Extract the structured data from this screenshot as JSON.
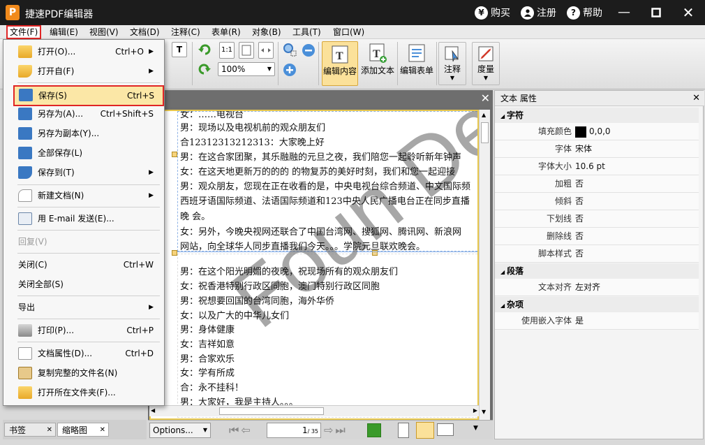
{
  "window": {
    "title": "捷速PDF编辑器",
    "logo_letter": "P",
    "links": [
      "购买",
      "注册",
      "帮助"
    ]
  },
  "menubar": [
    "文件(F)",
    "编辑(E)",
    "视图(V)",
    "文档(D)",
    "注释(C)",
    "表单(R)",
    "对象(B)",
    "工具(T)",
    "窗口(W)"
  ],
  "toolbar": {
    "zoom": "100%",
    "buttons": [
      "编辑内容",
      "添加文本",
      "编辑表单",
      "注释",
      "度量"
    ]
  },
  "file_menu": [
    {
      "label": "打开(O)...",
      "shortcut": "Ctrl+O",
      "submenu": true
    },
    {
      "label": "打开自(F)",
      "shortcut": "",
      "submenu": true
    },
    {
      "label": "保存(S)",
      "shortcut": "Ctrl+S",
      "submenu": false
    },
    {
      "label": "另存为(A)...",
      "shortcut": "Ctrl+Shift+S",
      "submenu": false
    },
    {
      "label": "另存为副本(Y)...",
      "shortcut": "",
      "submenu": false
    },
    {
      "label": "全部保存(L)",
      "shortcut": "",
      "submenu": false
    },
    {
      "label": "保存到(T)",
      "shortcut": "",
      "submenu": true
    },
    {
      "label": "新建文档(N)",
      "shortcut": "",
      "submenu": true
    },
    {
      "label": "用 E-mail 发送(E)...",
      "shortcut": "",
      "submenu": false
    },
    {
      "label": "回复(V)",
      "shortcut": "",
      "submenu": false
    },
    {
      "label": "关闭(C)",
      "shortcut": "Ctrl+W",
      "submenu": false
    },
    {
      "label": "关闭全部(S)",
      "shortcut": "",
      "submenu": false
    },
    {
      "label": "导出",
      "shortcut": "",
      "submenu": true
    },
    {
      "label": "打印(P)...",
      "shortcut": "Ctrl+P",
      "submenu": false
    },
    {
      "label": "文档属性(D)...",
      "shortcut": "Ctrl+D",
      "submenu": false
    },
    {
      "label": "复制完整的文件名(N)",
      "shortcut": "",
      "submenu": false
    },
    {
      "label": "打开所在文件夹(F)...",
      "shortcut": "",
      "submenu": false
    }
  ],
  "document": {
    "lines": [
      "女：……电视台",
      "男：现场以及电视机前的观众朋友们",
      "合12312313212313：大家晚上好",
      "男：在这合家团聚，其乐融融的元旦之夜，我们陪您一起聆听新年钟声",
      "女：在这天地更新万的的的  的物复苏的美好时刻，我们和您一起迎接",
      "男：观众朋友，您现在正在收看的是，中央电视台综合频道、中文国际频",
      "西班牙语国际频道、法语国际频道和123中央人民广播电台正在同步直播",
      "晚  会。",
      "女：另外，今晚央视网还联合了中国台湾网、搜狐网、腾讯网、新浪网",
      "网站，向全球华人同步直播我们今天。。。学院元旦联欢晚会。",
      "男：在这个阳光明媚的夜晚，祝现场所有的观众朋友们",
      "女：祝香港特别行政区同胞，澳门特别行政区同胞",
      "男：祝想要回国的台湾同胞，海外华侨",
      "女：以及广大的中华儿女们",
      "男：身体健康",
      "女：吉祥如意",
      "男：合家欢乐",
      "女：学有所成",
      "合：永不挂科！",
      "男：大家好，我是主持人。。。"
    ],
    "watermark": "Foun De",
    "page_current": "1",
    "page_total": "/ 35",
    "options_label": "Options..."
  },
  "properties": {
    "title": "文本 属性",
    "sections": [
      {
        "name": "字符",
        "rows": [
          {
            "k": "填充颜色",
            "v": "0,0,0"
          },
          {
            "k": "字体",
            "v": "宋体"
          },
          {
            "k": "字体大小",
            "v": "10.6 pt"
          },
          {
            "k": "加粗",
            "v": "否"
          },
          {
            "k": "倾斜",
            "v": "否"
          },
          {
            "k": "下划线",
            "v": "否"
          },
          {
            "k": "删除线",
            "v": "否"
          },
          {
            "k": "脚本样式",
            "v": "否"
          }
        ]
      },
      {
        "name": "段落",
        "rows": [
          {
            "k": "文本对齐",
            "v": "左对齐"
          }
        ]
      },
      {
        "name": "杂项",
        "rows": [
          {
            "k": "使用嵌入字体",
            "v": "是"
          }
        ]
      }
    ]
  },
  "left_tabs": [
    "书签",
    "缩略图"
  ],
  "colors": {
    "accent": "#f0c040",
    "highlight_border": "#e02525",
    "selected_item": "#fbe7a6"
  }
}
